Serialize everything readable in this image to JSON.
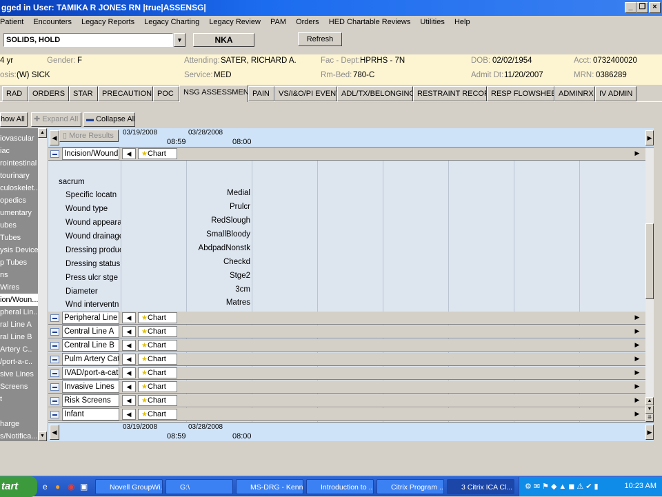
{
  "window": {
    "title": "gged in User: TAMIKA R JONES RN  |true|ASSENSG|"
  },
  "menu": [
    "Patient",
    "Encounters",
    "Legacy Reports",
    "Legacy Charting",
    "Legacy Review",
    "PAM",
    "Orders",
    "HED Chartable Reviews",
    "Utilities",
    "Help"
  ],
  "toolbar": {
    "diet": "SOLIDS, HOLD",
    "allergy": "NKA",
    "refresh": "Refresh"
  },
  "patient": {
    "age": "4 yr",
    "gender_label": "Gender:",
    "gender": "F",
    "attending_label": "Attending:",
    "attending": "SATER, RICHARD A.",
    "facdept_label": "Fac - Dept:",
    "facdept": "HPRHS - 7N",
    "dob_label": "DOB:",
    "dob": "02/02/1954",
    "acct_label": "Acct:",
    "acct": "0732400020",
    "diag_label": "osis:",
    "diag": "(W) SICK",
    "service_label": "Service:",
    "service": "MED",
    "rmbed_label": "Rm-Bed:",
    "rmbed": "780-C",
    "admit_label": "Admit Dt:",
    "admit": "11/20/2007",
    "mrn_label": "MRN:",
    "mrn": "0386289"
  },
  "tabs": [
    "RAD",
    "ORDERS",
    "STAR",
    "PRECAUTIONS",
    "POC",
    "NSG ASSESSMENT",
    "PAIN",
    "VS/I&O/PI EVENT",
    "ADL/TX/BELONGINGS",
    "RESTRAINT RECORD",
    "RESP FLOWSHEET",
    "ADMINRX",
    "IV ADMIN"
  ],
  "view": {
    "show_all": "how All",
    "expand_all": "Expand All",
    "collapse_all": "Collapse All",
    "more_results": "More Results"
  },
  "nav": [
    "iovascular",
    "iac",
    "rointestinal",
    "tourinary",
    "culoskelet..",
    "opedics",
    "umentary",
    "ubes",
    "Tubes",
    "ysis Device",
    "p Tubes",
    "ns",
    "Wires",
    "ion/Woun...",
    "pheral Lin..",
    "ral Line A",
    "ral Line B",
    "Artery C..",
    "/port-a-c..",
    "sive Lines",
    "Screens",
    "t",
    "",
    "harge",
    "s/Notifica..."
  ],
  "dates": [
    {
      "date": "03/19/2008",
      "time": "08:59"
    },
    {
      "date": "03/28/2008",
      "time": "08:00"
    }
  ],
  "section": {
    "label": "Incision/Wound",
    "chart": "Chart",
    "site": "sacrum",
    "fields": [
      {
        "label": "Specific locatn",
        "value": "Medial"
      },
      {
        "label": "Wound type",
        "value": "Prulcr"
      },
      {
        "label": "Wound appearance",
        "value": "RedSlough"
      },
      {
        "label": "Wound drainage",
        "value": "SmallBloody"
      },
      {
        "label": "Dressing product",
        "value": "AbdpadNonstk"
      },
      {
        "label": "Dressing status",
        "value": "Checkd"
      },
      {
        "label": "Press ulcr stge",
        "value": "Stge2"
      },
      {
        "label": "Diameter",
        "value": "3cm"
      },
      {
        "label": "Wnd interventn",
        "value": "Matres"
      }
    ]
  },
  "rows": [
    "Peripheral Line",
    "Central Line A",
    "Central Line B",
    "Pulm  Artery Cat",
    "IVAD/port-a-cat",
    "Invasive Lines",
    "Risk Screens",
    "Infant"
  ],
  "taskbar": {
    "start": "tart",
    "items": [
      "Novell GroupWi...",
      "G:\\",
      "MS-DRG - Kenn...",
      "Introduction to ...",
      "Citrix Program ...",
      "3 Citrix ICA Cl..."
    ],
    "clock": "10:23 AM"
  }
}
